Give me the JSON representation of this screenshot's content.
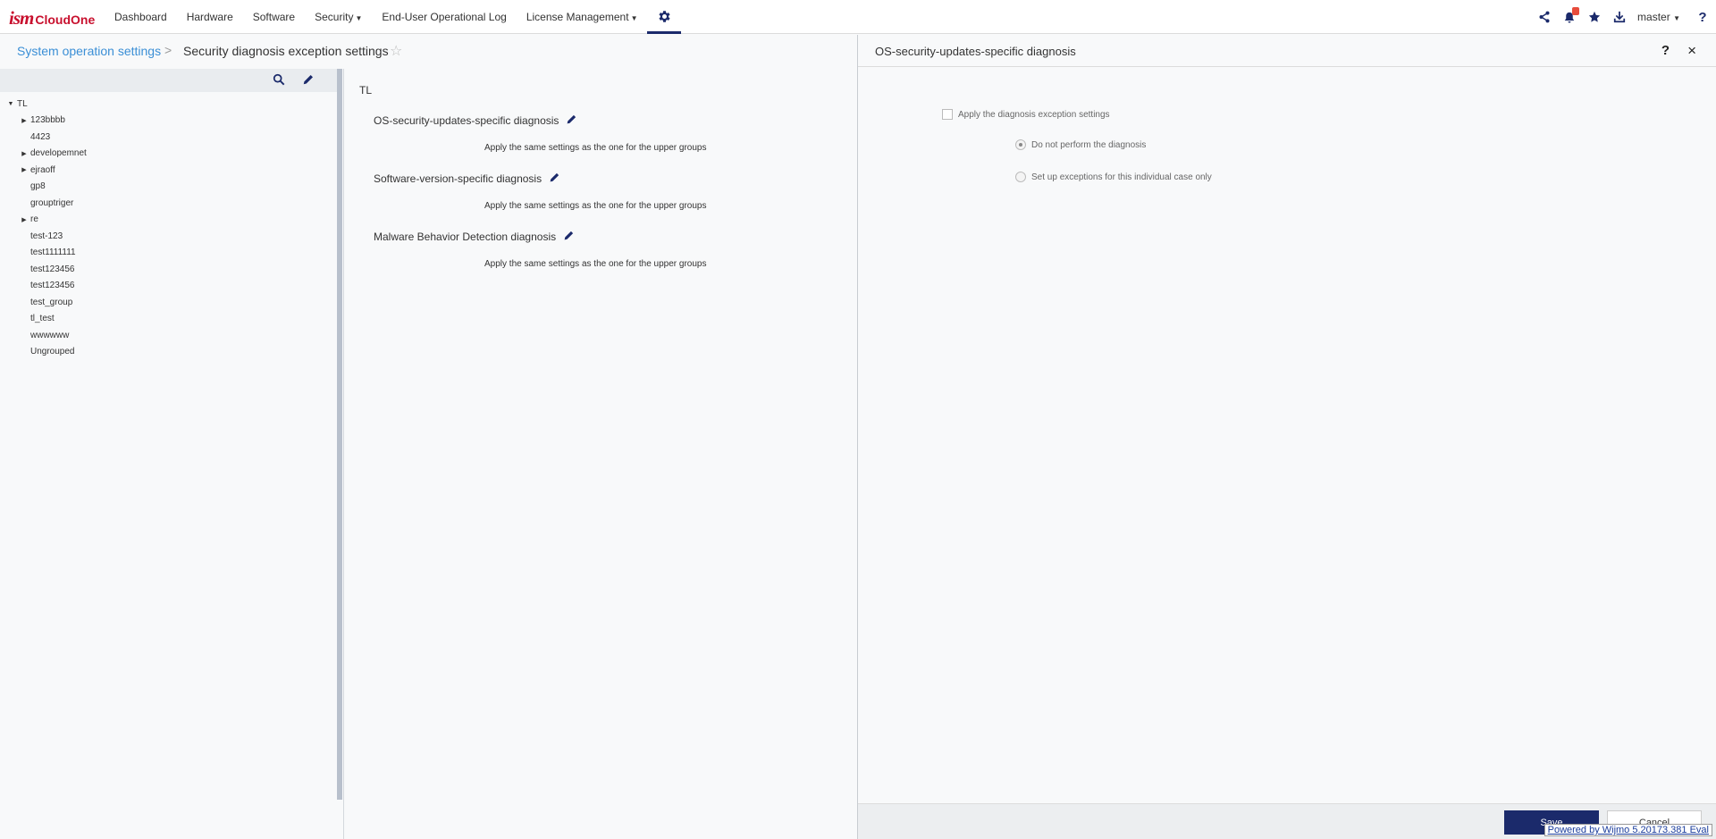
{
  "header": {
    "logo_ism": "ism",
    "logo_cloud": "CloudOne",
    "nav": [
      {
        "label": "Dashboard",
        "dropdown": false
      },
      {
        "label": "Hardware",
        "dropdown": false
      },
      {
        "label": "Software",
        "dropdown": false
      },
      {
        "label": "Security",
        "dropdown": true
      },
      {
        "label": "End-User Operational Log",
        "dropdown": false
      },
      {
        "label": "License Management",
        "dropdown": true
      }
    ],
    "user": "master",
    "help": "?",
    "icons": [
      "share-icon",
      "bell-icon",
      "star-icon",
      "download-icon",
      "gear-icon"
    ]
  },
  "breadcrumb": {
    "parent": "System operation settings",
    "separator": ">",
    "current": "Security diagnosis exception settings",
    "star": "☆"
  },
  "tree": {
    "root": "TL",
    "items": [
      {
        "label": "123bbbb",
        "expandable": true
      },
      {
        "label": "4423",
        "expandable": false
      },
      {
        "label": "developemnet",
        "expandable": true
      },
      {
        "label": "ejraoff",
        "expandable": true
      },
      {
        "label": "gp8",
        "expandable": false
      },
      {
        "label": "grouptriger",
        "expandable": false
      },
      {
        "label": "re",
        "expandable": true
      },
      {
        "label": "test-123",
        "expandable": false
      },
      {
        "label": "test1111111",
        "expandable": false
      },
      {
        "label": "test123456",
        "expandable": false
      },
      {
        "label": "test123456",
        "expandable": false
      },
      {
        "label": "test_group",
        "expandable": false
      },
      {
        "label": "tl_test",
        "expandable": false
      },
      {
        "label": "wwwwww",
        "expandable": false
      },
      {
        "label": "Ungrouped",
        "expandable": false
      }
    ]
  },
  "middle": {
    "group": "TL",
    "diagnoses": [
      {
        "title": "OS-security-updates-specific diagnosis",
        "setting": "Apply the same settings as the one for the upper groups"
      },
      {
        "title": "Software-version-specific diagnosis",
        "setting": "Apply the same settings as the one for the upper groups"
      },
      {
        "title": "Malware Behavior Detection diagnosis",
        "setting": "Apply the same settings as the one for the upper groups"
      }
    ]
  },
  "panel": {
    "title": "OS-security-updates-specific diagnosis",
    "help": "?",
    "close": "×",
    "checkbox_label": "Apply the diagnosis exception settings",
    "radio_options": [
      {
        "label": "Do not perform the diagnosis",
        "selected": true
      },
      {
        "label": "Set up exceptions for this individual case only",
        "selected": false
      }
    ],
    "save_label": "Save",
    "cancel_label": "Cancel",
    "watermark": "Powered by Wijmo 5.20173.381 Eval"
  },
  "colors": {
    "brand_red": "#c8102e",
    "navy": "#1b2a6b",
    "link_blue": "#3b8fd6"
  }
}
